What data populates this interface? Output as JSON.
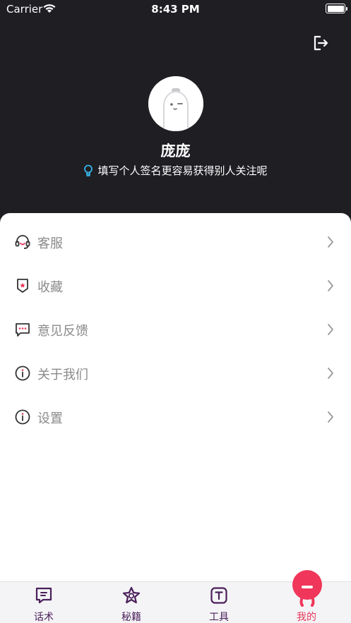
{
  "status_bar": {
    "carrier": "Carrier",
    "time": "8:43 PM"
  },
  "header": {
    "logout_icon": "logout-icon",
    "nickname": "庞庞",
    "signature": "填写个人签名更容易获得别人关注呢",
    "signature_icon": "lightbulb-icon"
  },
  "menu": [
    {
      "label": "客服",
      "icon": "headset-icon"
    },
    {
      "label": "收藏",
      "icon": "favorite-badge-icon"
    },
    {
      "label": "意见反馈",
      "icon": "feedback-bubble-icon"
    },
    {
      "label": "关于我们",
      "icon": "info-icon"
    },
    {
      "label": "设置",
      "icon": "settings-info-icon"
    }
  ],
  "tabbar": {
    "tabs": [
      {
        "label": "话术",
        "icon": "chat-script-icon"
      },
      {
        "label": "秘籍",
        "icon": "star-icon"
      },
      {
        "label": "工具",
        "icon": "tool-t-icon"
      },
      {
        "label": "我的",
        "icon": "mine-mascot-icon",
        "active": true
      }
    ]
  },
  "colors": {
    "header_bg": "#1f1e23",
    "accent": "#f0365a",
    "tab_inactive": "#4a1f5a"
  }
}
